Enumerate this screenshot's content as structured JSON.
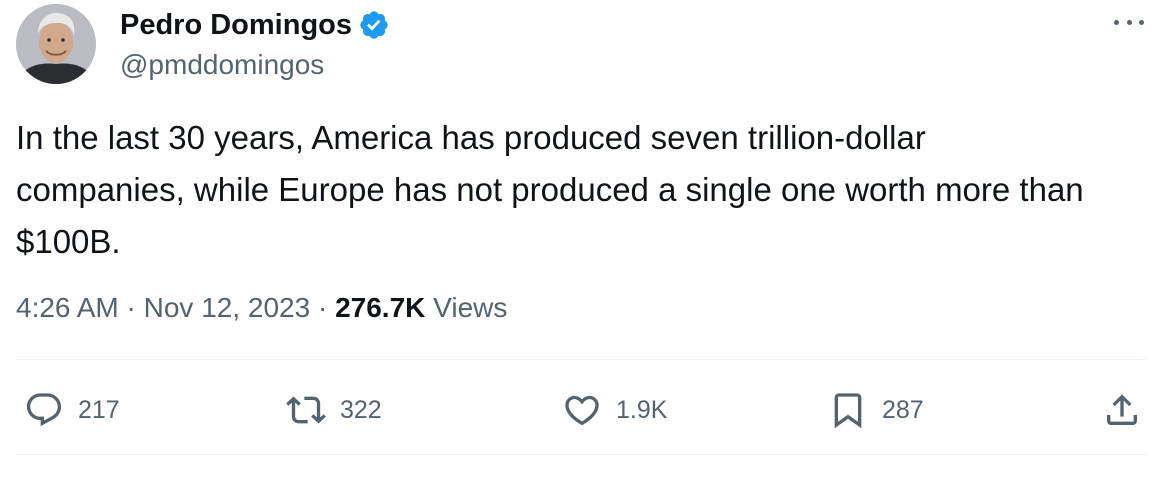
{
  "author": {
    "name": "Pedro Domingos",
    "handle": "@pmddomingos",
    "verified": true,
    "avatar_icon": "profile-photo"
  },
  "tweet": {
    "text": "In the last 30 years, America has produced seven trillion-dollar\ncompanies, while Europe has not produced a single one worth more than\n$100B.",
    "time": "4:26 AM",
    "date": "Nov 12, 2023",
    "views_count": "276.7K",
    "views_label": "Views"
  },
  "actions": {
    "reply": {
      "icon": "reply-icon",
      "count": "217"
    },
    "retweet": {
      "icon": "retweet-icon",
      "count": "322"
    },
    "like": {
      "icon": "heart-icon",
      "count": "1.9K"
    },
    "bookmark": {
      "icon": "bookmark-icon",
      "count": "287"
    },
    "share": {
      "icon": "share-icon"
    }
  },
  "colors": {
    "text": "#0f1419",
    "secondary": "#536471",
    "verified": "#1d9bf0",
    "divider": "#eff3f4"
  }
}
